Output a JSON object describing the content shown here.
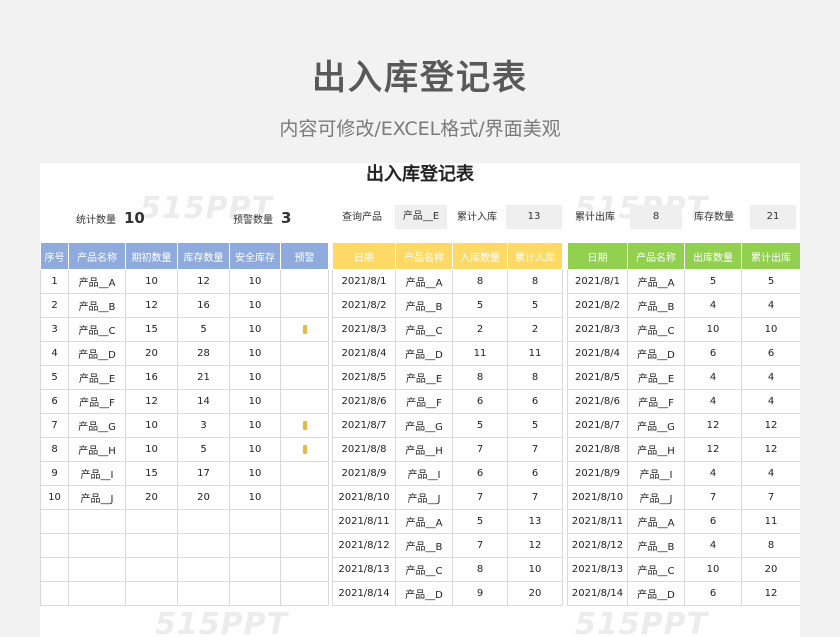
{
  "hero": {
    "title": "出入库登记表",
    "subtitle": "内容可修改/EXCEL格式/界面美观"
  },
  "sheet": {
    "title": "出入库登记表",
    "stats": {
      "count_label": "统计数量",
      "count_value": "10",
      "alert_label": "预警数量",
      "alert_value": "3",
      "query_label": "查询产品",
      "query_value": "产品__E",
      "in_total_label": "累计入库",
      "in_total_value": "13",
      "out_total_label": "累计出库",
      "out_total_value": "8",
      "stock_label": "库存数量",
      "stock_value": "21"
    },
    "watermark": "515PPT",
    "inventory": {
      "headers": [
        "序号",
        "产品名称",
        "期初数量",
        "库存数量",
        "安全库存",
        "预警"
      ],
      "rows": [
        [
          "1",
          "产品__A",
          "10",
          "12",
          "10",
          ""
        ],
        [
          "2",
          "产品__B",
          "12",
          "16",
          "10",
          ""
        ],
        [
          "3",
          "产品__C",
          "15",
          "5",
          "10",
          "warn"
        ],
        [
          "4",
          "产品__D",
          "20",
          "28",
          "10",
          ""
        ],
        [
          "5",
          "产品__E",
          "16",
          "21",
          "10",
          ""
        ],
        [
          "6",
          "产品__F",
          "12",
          "14",
          "10",
          ""
        ],
        [
          "7",
          "产品__G",
          "10",
          "3",
          "10",
          "warn"
        ],
        [
          "8",
          "产品__H",
          "10",
          "5",
          "10",
          "warn"
        ],
        [
          "9",
          "产品__I",
          "15",
          "17",
          "10",
          ""
        ],
        [
          "10",
          "产品__J",
          "20",
          "20",
          "10",
          ""
        ],
        [
          "",
          "",
          "",
          "",
          "",
          ""
        ],
        [
          "",
          "",
          "",
          "",
          "",
          ""
        ],
        [
          "",
          "",
          "",
          "",
          "",
          ""
        ],
        [
          "",
          "",
          "",
          "",
          "",
          ""
        ]
      ]
    },
    "inbound": {
      "headers": [
        "日期",
        "产品名称",
        "入库数量",
        "累计入库"
      ],
      "rows": [
        [
          "2021/8/1",
          "产品__A",
          "8",
          "8"
        ],
        [
          "2021/8/2",
          "产品__B",
          "5",
          "5"
        ],
        [
          "2021/8/3",
          "产品__C",
          "2",
          "2"
        ],
        [
          "2021/8/4",
          "产品__D",
          "11",
          "11"
        ],
        [
          "2021/8/5",
          "产品__E",
          "8",
          "8"
        ],
        [
          "2021/8/6",
          "产品__F",
          "6",
          "6"
        ],
        [
          "2021/8/7",
          "产品__G",
          "5",
          "5"
        ],
        [
          "2021/8/8",
          "产品__H",
          "7",
          "7"
        ],
        [
          "2021/8/9",
          "产品__I",
          "6",
          "6"
        ],
        [
          "2021/8/10",
          "产品__J",
          "7",
          "7"
        ],
        [
          "2021/8/11",
          "产品__A",
          "5",
          "13"
        ],
        [
          "2021/8/12",
          "产品__B",
          "7",
          "12"
        ],
        [
          "2021/8/13",
          "产品__C",
          "8",
          "10"
        ],
        [
          "2021/8/14",
          "产品__D",
          "9",
          "20"
        ]
      ]
    },
    "outbound": {
      "headers": [
        "日期",
        "产品名称",
        "出库数量",
        "累计出库"
      ],
      "rows": [
        [
          "2021/8/1",
          "产品__A",
          "5",
          "5"
        ],
        [
          "2021/8/2",
          "产品__B",
          "4",
          "4"
        ],
        [
          "2021/8/3",
          "产品__C",
          "10",
          "10"
        ],
        [
          "2021/8/4",
          "产品__D",
          "6",
          "6"
        ],
        [
          "2021/8/5",
          "产品__E",
          "4",
          "4"
        ],
        [
          "2021/8/6",
          "产品__F",
          "4",
          "4"
        ],
        [
          "2021/8/7",
          "产品__G",
          "12",
          "12"
        ],
        [
          "2021/8/8",
          "产品__H",
          "12",
          "12"
        ],
        [
          "2021/8/9",
          "产品__I",
          "4",
          "4"
        ],
        [
          "2021/8/10",
          "产品__J",
          "7",
          "7"
        ],
        [
          "2021/8/11",
          "产品__A",
          "6",
          "11"
        ],
        [
          "2021/8/12",
          "产品__B",
          "4",
          "8"
        ],
        [
          "2021/8/13",
          "产品__C",
          "10",
          "20"
        ],
        [
          "2021/8/14",
          "产品__D",
          "6",
          "12"
        ]
      ]
    }
  },
  "colors": {
    "inventory_header": "#8faadc",
    "inbound_header": "#ffd966",
    "outbound_header": "#92d050",
    "warn": "#e6b84a"
  }
}
